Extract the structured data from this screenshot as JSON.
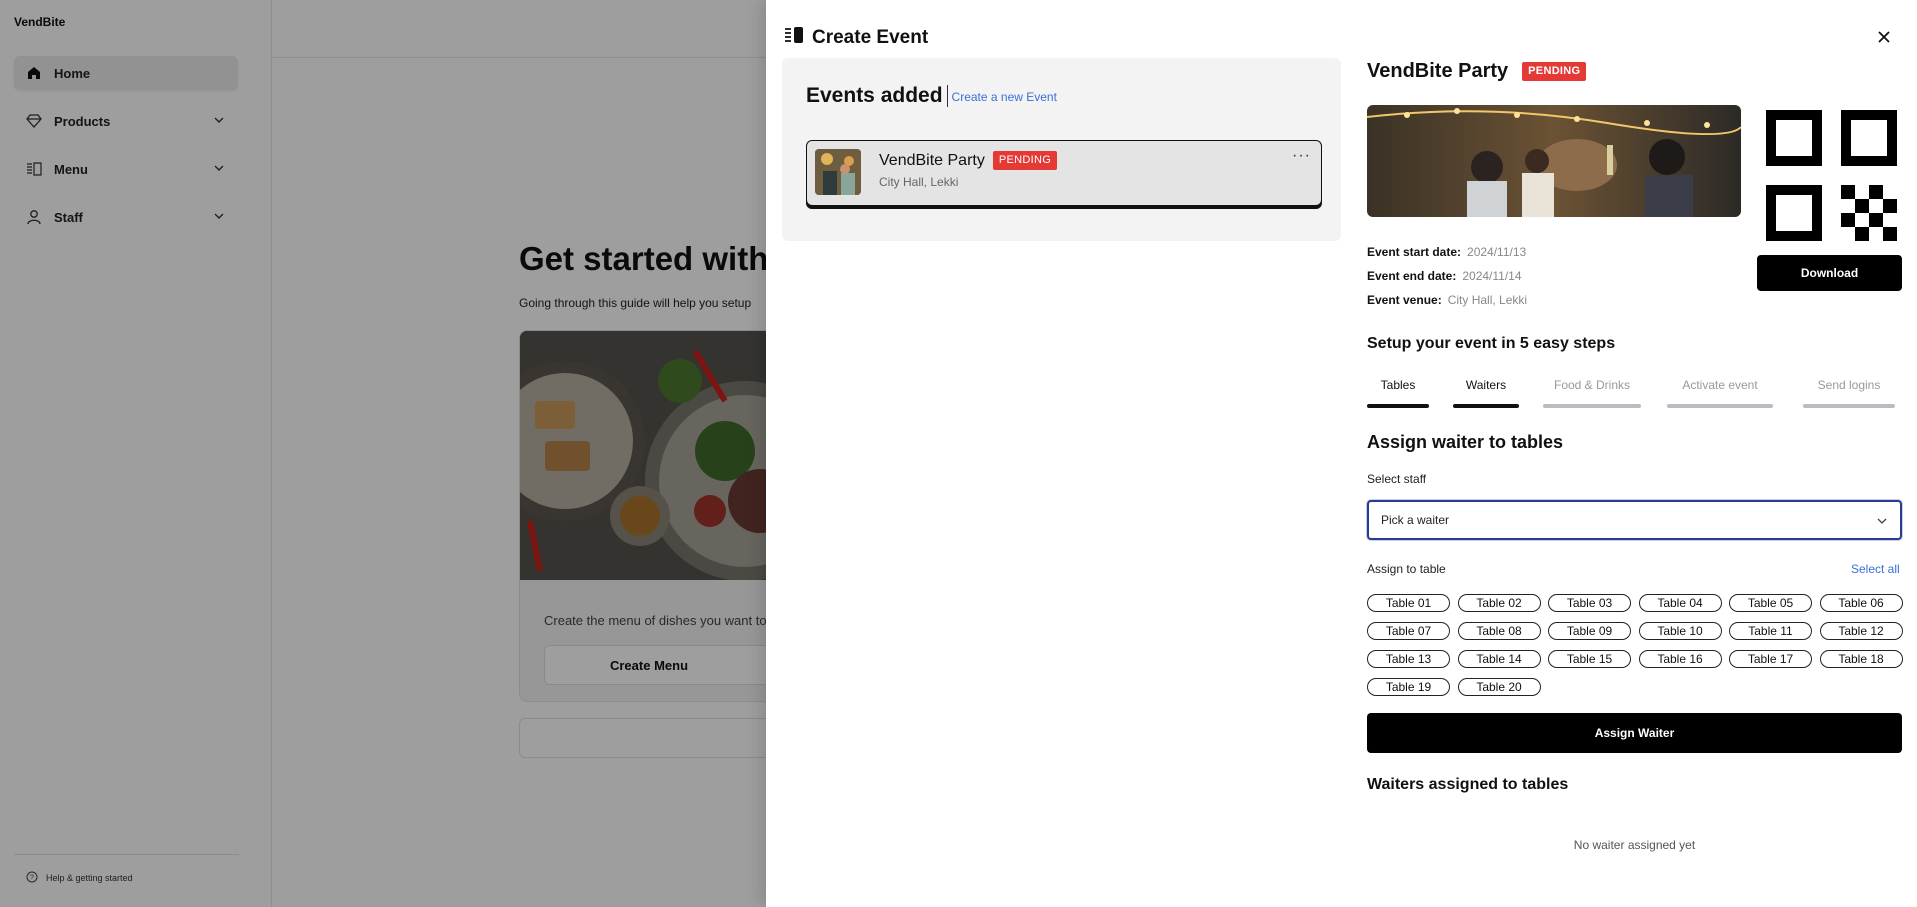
{
  "app": {
    "brand": "VendBite",
    "sidebar": {
      "items": [
        {
          "label": "Home",
          "icon": "home-icon",
          "active": true
        },
        {
          "label": "Products",
          "icon": "diamond-icon"
        },
        {
          "label": "Menu",
          "icon": "menu-book-icon"
        },
        {
          "label": "Staff",
          "icon": "user-icon"
        }
      ],
      "help": "Help & getting started"
    },
    "main": {
      "title": "Get started with V",
      "subtitle": "Going through this guide will help you setup",
      "card_text": "Create the menu of dishes you want to",
      "card_button": "Create Menu"
    }
  },
  "drawer": {
    "title": "Create Event",
    "events_heading": "Events added",
    "create_link": "Create a new Event",
    "events": [
      {
        "name": "VendBite Party",
        "status": "PENDING",
        "location": "City Hall, Lekki"
      }
    ],
    "detail": {
      "name": "VendBite Party",
      "status": "PENDING",
      "start_label": "Event start date:",
      "start_value": "2024/11/13",
      "end_label": "Event end date:",
      "end_value": "2024/11/14",
      "venue_label": "Event venue:",
      "venue_value": "City Hall, Lekki",
      "download": "Download"
    },
    "steps_title": "Setup your event in 5 easy steps",
    "tabs": [
      {
        "label": "Tables",
        "done": true
      },
      {
        "label": "Waiters",
        "done": true
      },
      {
        "label": "Food & Drinks",
        "done": false
      },
      {
        "label": "Activate event",
        "done": false
      },
      {
        "label": "Send logins",
        "done": false
      }
    ],
    "assign_title": "Assign waiter to tables",
    "select_staff_label": "Select staff",
    "select_placeholder": "Pick a waiter",
    "assign_to_table_label": "Assign to table",
    "select_all": "Select all",
    "tables": [
      "Table 01",
      "Table 02",
      "Table 03",
      "Table 04",
      "Table 05",
      "Table 06",
      "Table 07",
      "Table 08",
      "Table 09",
      "Table 10",
      "Table 11",
      "Table 12",
      "Table 13",
      "Table 14",
      "Table 15",
      "Table 16",
      "Table 17",
      "Table 18",
      "Table 19",
      "Table 20"
    ],
    "assign_button": "Assign Waiter",
    "assigned_title": "Waiters assigned to tables",
    "empty_text": "No waiter assigned yet"
  },
  "colors": {
    "accent_link": "#3a6fd8",
    "badge": "#e53935",
    "select_border": "#2a3a8c"
  }
}
